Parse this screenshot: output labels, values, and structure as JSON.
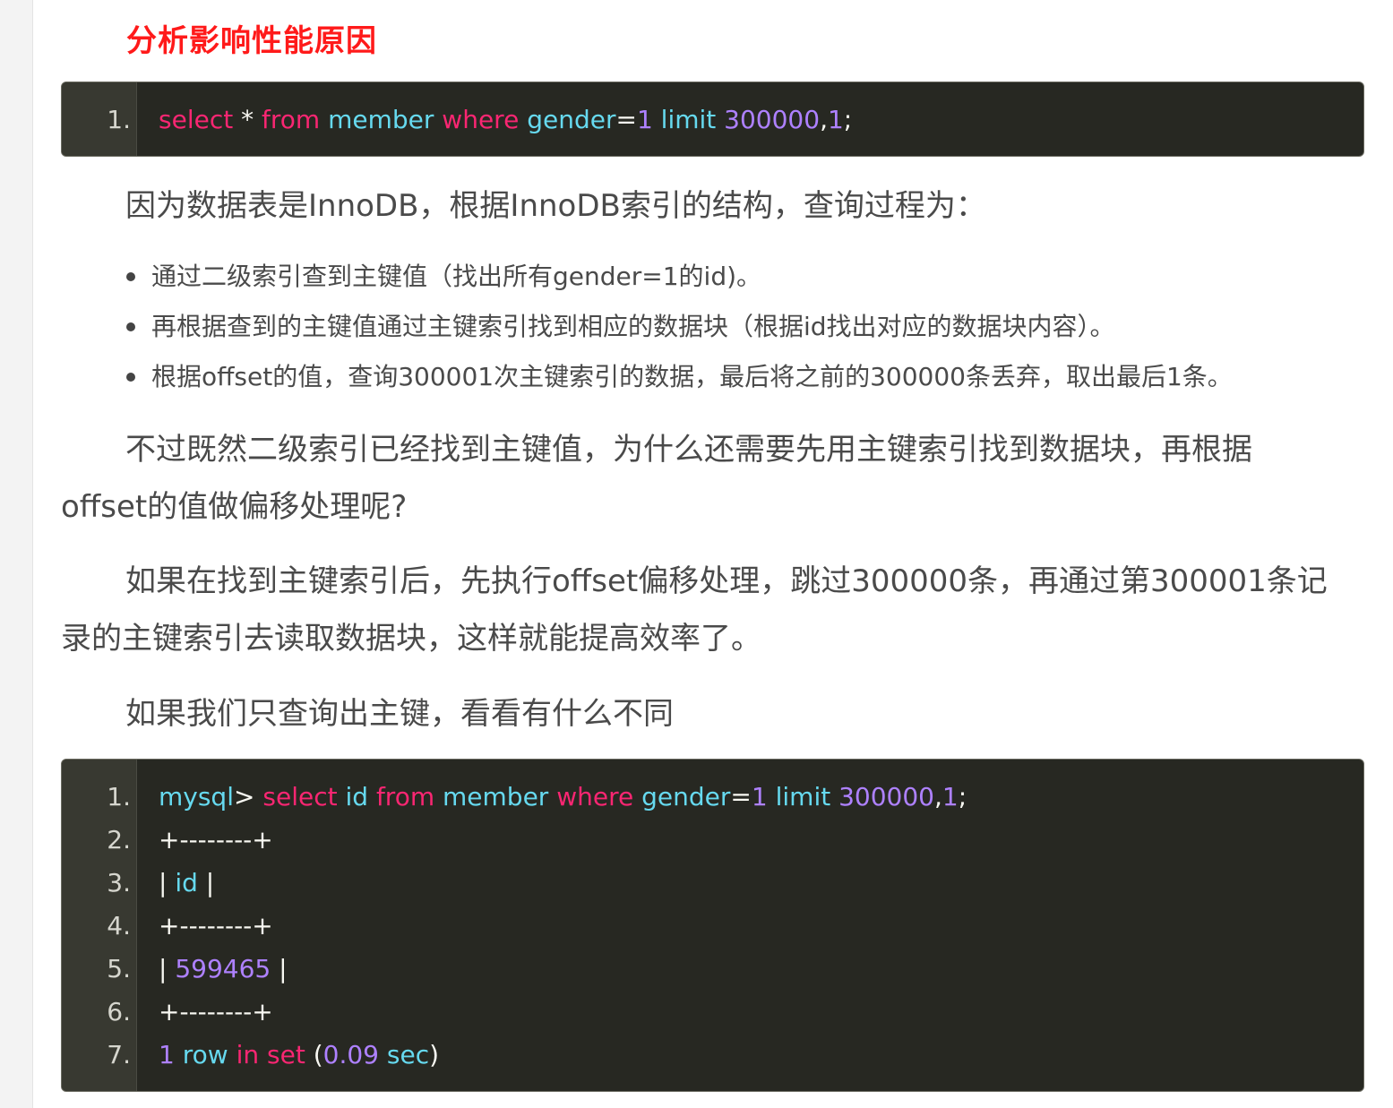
{
  "heading": "分析影响性能原因",
  "code_block_1": {
    "lines": [
      {
        "number": "1.",
        "tokens": [
          {
            "t": "select",
            "c": "kw"
          },
          {
            "t": " * ",
            "c": "pl"
          },
          {
            "t": "from",
            "c": "kw"
          },
          {
            "t": " ",
            "c": "pl"
          },
          {
            "t": "member",
            "c": "id"
          },
          {
            "t": " ",
            "c": "pl"
          },
          {
            "t": "where",
            "c": "kw"
          },
          {
            "t": " ",
            "c": "pl"
          },
          {
            "t": "gender",
            "c": "id"
          },
          {
            "t": "=",
            "c": "pl"
          },
          {
            "t": "1",
            "c": "num"
          },
          {
            "t": " ",
            "c": "pl"
          },
          {
            "t": "limit",
            "c": "id"
          },
          {
            "t": " ",
            "c": "pl"
          },
          {
            "t": "300000",
            "c": "num"
          },
          {
            "t": ",",
            "c": "pl"
          },
          {
            "t": "1",
            "c": "num"
          },
          {
            "t": ";",
            "c": "pl"
          }
        ]
      }
    ]
  },
  "para_1": "因为数据表是InnoDB，根据InnoDB索引的结构，查询过程为：",
  "bullets": [
    "通过二级索引查到主键值（找出所有gender=1的id)。",
    "再根据查到的主键值通过主键索引找到相应的数据块（根据id找出对应的数据块内容）。",
    "根据offset的值，查询300001次主键索引的数据，最后将之前的300000条丢弃，取出最后1条。"
  ],
  "para_2": "不过既然二级索引已经找到主键值，为什么还需要先用主键索引找到数据块，再根据offset的值做偏移处理呢?",
  "para_3": "如果在找到主键索引后，先执行offset偏移处理，跳过300000条，再通过第300001条记录的主键索引去读取数据块，这样就能提高效率了。",
  "para_4": "如果我们只查询出主键，看看有什么不同",
  "code_block_2": {
    "lines": [
      {
        "number": "1.",
        "tokens": [
          {
            "t": "mysql",
            "c": "id"
          },
          {
            "t": "> ",
            "c": "pl"
          },
          {
            "t": "select",
            "c": "kw"
          },
          {
            "t": " ",
            "c": "pl"
          },
          {
            "t": "id",
            "c": "id"
          },
          {
            "t": " ",
            "c": "pl"
          },
          {
            "t": "from",
            "c": "kw"
          },
          {
            "t": " ",
            "c": "pl"
          },
          {
            "t": "member",
            "c": "id"
          },
          {
            "t": " ",
            "c": "pl"
          },
          {
            "t": "where",
            "c": "kw"
          },
          {
            "t": " ",
            "c": "pl"
          },
          {
            "t": "gender",
            "c": "id"
          },
          {
            "t": "=",
            "c": "pl"
          },
          {
            "t": "1",
            "c": "num"
          },
          {
            "t": " ",
            "c": "pl"
          },
          {
            "t": "limit",
            "c": "id"
          },
          {
            "t": " ",
            "c": "pl"
          },
          {
            "t": "300000",
            "c": "num"
          },
          {
            "t": ",",
            "c": "pl"
          },
          {
            "t": "1",
            "c": "num"
          },
          {
            "t": ";",
            "c": "pl"
          }
        ]
      },
      {
        "number": "2.",
        "tokens": [
          {
            "t": "+--------+",
            "c": "pl"
          }
        ]
      },
      {
        "number": "3.",
        "tokens": [
          {
            "t": "| ",
            "c": "pl"
          },
          {
            "t": "id",
            "c": "id"
          },
          {
            "t": " |",
            "c": "pl"
          }
        ]
      },
      {
        "number": "4.",
        "tokens": [
          {
            "t": "+--------+",
            "c": "pl"
          }
        ]
      },
      {
        "number": "5.",
        "tokens": [
          {
            "t": "| ",
            "c": "pl"
          },
          {
            "t": "599465",
            "c": "num"
          },
          {
            "t": " |",
            "c": "pl"
          }
        ]
      },
      {
        "number": "6.",
        "tokens": [
          {
            "t": "+--------+",
            "c": "pl"
          }
        ]
      },
      {
        "number": "7.",
        "tokens": [
          {
            "t": "1",
            "c": "num"
          },
          {
            "t": " ",
            "c": "pl"
          },
          {
            "t": "row",
            "c": "id"
          },
          {
            "t": " ",
            "c": "pl"
          },
          {
            "t": "in",
            "c": "kw"
          },
          {
            "t": " ",
            "c": "pl"
          },
          {
            "t": "set",
            "c": "kw"
          },
          {
            "t": " (",
            "c": "pl"
          },
          {
            "t": "0.09",
            "c": "num"
          },
          {
            "t": " ",
            "c": "pl"
          },
          {
            "t": "sec",
            "c": "id"
          },
          {
            "t": ")",
            "c": "pl"
          }
        ]
      }
    ]
  },
  "colors": {
    "heading": "#ff1a1a",
    "code_background": "#272822",
    "code_gutter": "#383931",
    "keyword": "#f92672",
    "identifier": "#66d9ef",
    "number": "#ae81ff",
    "plain": "#f8f8f2",
    "body_text": "#4a4a4a"
  }
}
